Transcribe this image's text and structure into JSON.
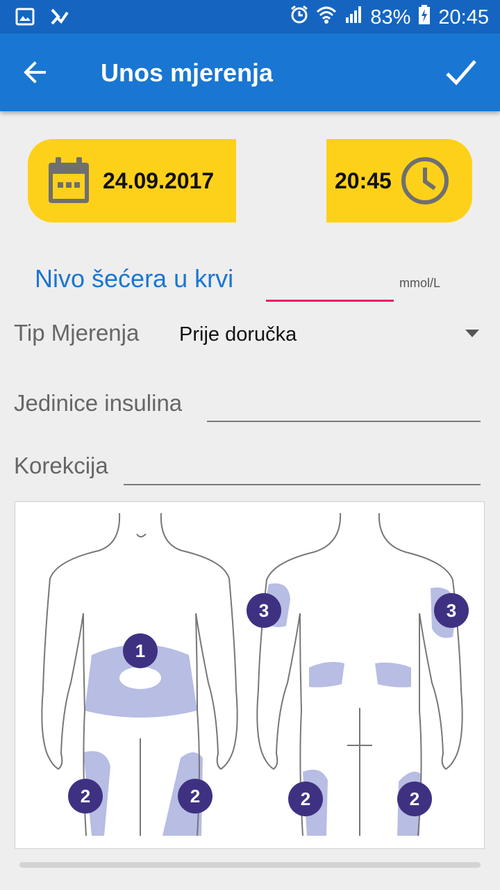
{
  "status_bar": {
    "battery": "83%",
    "time": "20:45",
    "icons": [
      "image-icon",
      "check-notification-icon",
      "alarm-icon",
      "wifi-icon",
      "signal-icon",
      "battery-charging-icon"
    ]
  },
  "toolbar": {
    "title": "Unos mjerenja",
    "back_icon": "arrow-left-icon",
    "confirm_icon": "checkmark-icon"
  },
  "date_button": {
    "value": "24.09.2017",
    "icon": "calendar-icon"
  },
  "time_button": {
    "value": "20:45",
    "icon": "clock-icon"
  },
  "blood_sugar": {
    "label": "Nivo šećera u krvi",
    "value": "",
    "unit": "mmol/L"
  },
  "measurement_type": {
    "label": "Tip Mjerenja",
    "selected": "Prije doručka"
  },
  "insulin_units": {
    "label": "Jedinice insulina",
    "value": ""
  },
  "correction": {
    "label": "Korekcija",
    "value": ""
  },
  "injection_zones": {
    "front": [
      "1",
      "2",
      "2"
    ],
    "back": [
      "3",
      "3",
      "2",
      "2"
    ]
  },
  "colors": {
    "status_bar": "#1565c0",
    "app_bar": "#1976d2",
    "accent_yellow": "#fdd11a",
    "field_focus": "#e91e63",
    "zone_fill": "#b7bde3",
    "zone_marker": "#3f3182"
  }
}
